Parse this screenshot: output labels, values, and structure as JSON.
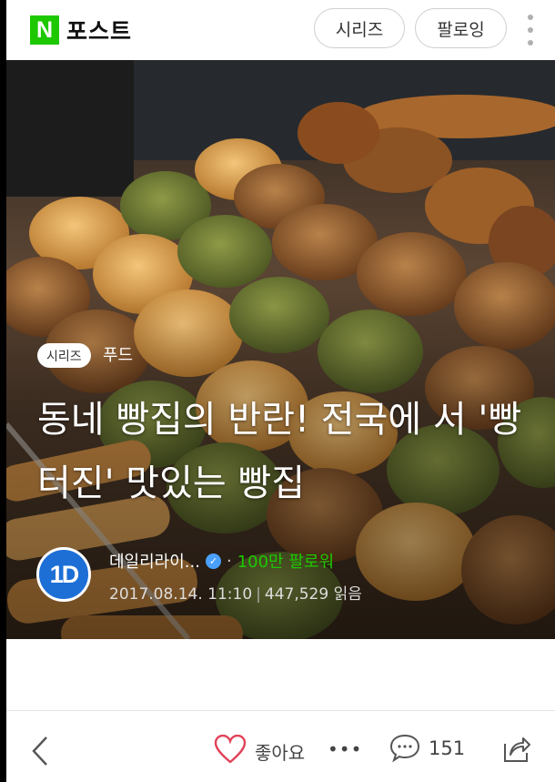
{
  "header": {
    "logo_letter": "N",
    "brand": "포스트",
    "series_button": "시리즈",
    "follow_button": "팔로잉"
  },
  "article": {
    "tag": "시리즈",
    "category": "푸드",
    "title": "동네 빵집의 반란! 전국에 서 '빵 터진' 맛있는 빵집",
    "author": {
      "avatar_text": "1D",
      "name": "데일리라이...",
      "separator": "·",
      "followers": "100만 팔로워"
    },
    "date": "2017.08.14. 11:10",
    "meta_sep": "|",
    "views": "447,529 읽음"
  },
  "bottom_bar": {
    "like_label": "좋아요",
    "more_label": "•••",
    "comment_count": "151"
  },
  "colors": {
    "brand_green": "#1ec800",
    "avatar_blue": "#1d6fd6",
    "heart_red": "#e0445a"
  }
}
